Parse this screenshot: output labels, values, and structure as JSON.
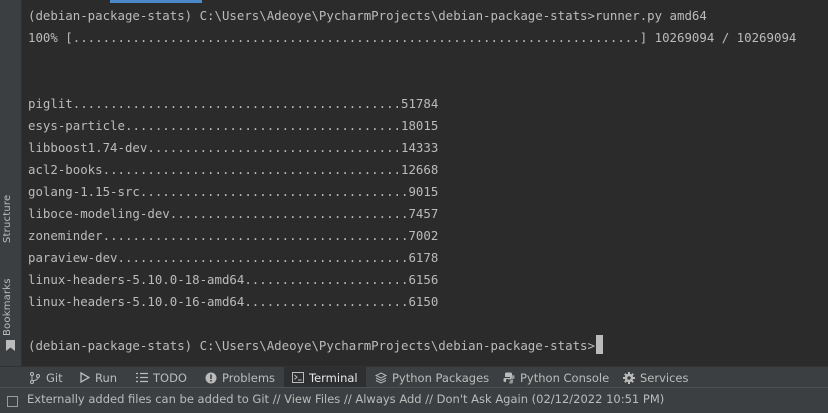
{
  "side_panel": {
    "structure_label": "Structure",
    "bookmarks_label": "Bookmarks"
  },
  "terminal": {
    "command_line": "(debian-package-stats) C:\\Users\\Adeoye\\PycharmProjects\\debian-package-stats>runner.py amd64",
    "progress_line": "100% [............................................................................] 10269094 / 10269094",
    "results": [
      {
        "name": "piglit",
        "count": "51784"
      },
      {
        "name": "esys-particle",
        "count": "18015"
      },
      {
        "name": "libboost1.74-dev",
        "count": "14333"
      },
      {
        "name": "acl2-books",
        "count": "12668"
      },
      {
        "name": "golang-1.15-src",
        "count": "9015"
      },
      {
        "name": "liboce-modeling-dev",
        "count": "7457"
      },
      {
        "name": "zoneminder",
        "count": "7002"
      },
      {
        "name": "paraview-dev",
        "count": "6178"
      },
      {
        "name": "linux-headers-5.10.0-18-amd64",
        "count": "6156"
      },
      {
        "name": "linux-headers-5.10.0-16-amd64",
        "count": "6150"
      }
    ],
    "prompt": "(debian-package-stats) C:\\Users\\Adeoye\\PycharmProjects\\debian-package-stats>"
  },
  "toolbar": {
    "git": "Git",
    "run": "Run",
    "todo": "TODO",
    "problems": "Problems",
    "terminal": "Terminal",
    "python_packages": "Python Packages",
    "python_console": "Python Console",
    "services": "Services"
  },
  "status_bar": {
    "message": "Externally added files can be added to Git // View Files // Always Add // Don't Ask Again (02/12/2022 10:51 PM)"
  },
  "colors": {
    "background": "#2b2b2b",
    "text": "#bbbbbb",
    "accent": "#4a88c7"
  }
}
